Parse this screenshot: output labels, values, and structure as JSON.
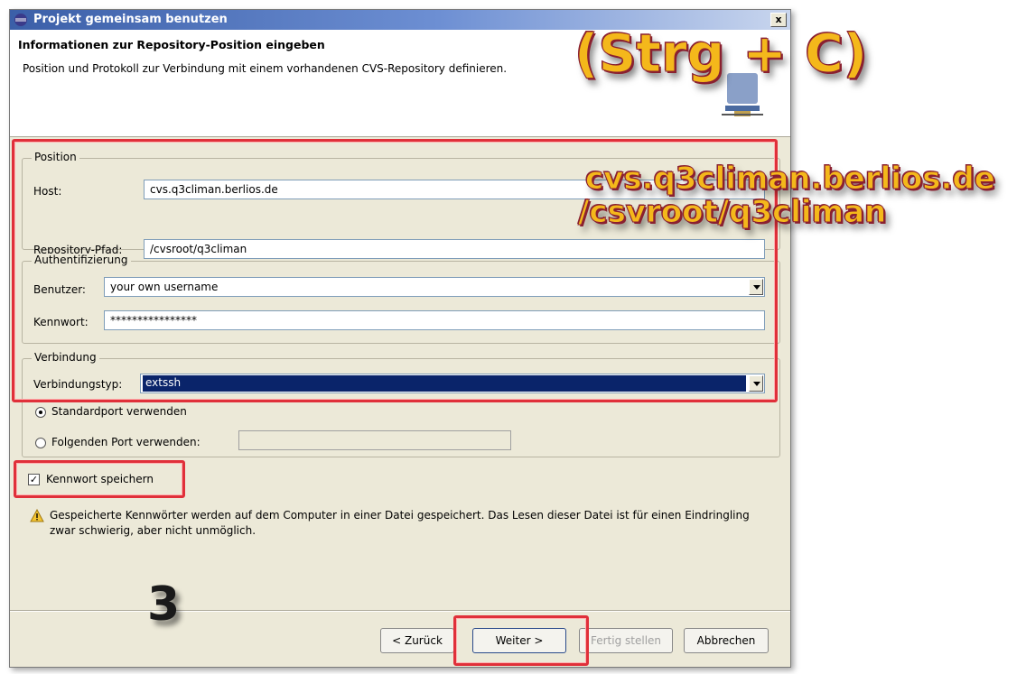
{
  "window": {
    "title": "Projekt gemeinsam benutzen",
    "close_label": "x"
  },
  "banner": {
    "heading": "Informationen zur Repository-Position eingeben",
    "description": "Position und Protokoll zur Verbindung mit einem vorhandenen CVS-Repository definieren."
  },
  "position_group": {
    "legend": "Position",
    "host_label": "Host:",
    "host_value": "cvs.q3climan.berlios.de",
    "path_label": "Repository-Pfad:",
    "path_value": "/cvsroot/q3climan"
  },
  "auth_group": {
    "legend": "Authentifizierung",
    "user_label": "Benutzer:",
    "user_value": "your own username",
    "password_label": "Kennwort:",
    "password_value": "****************"
  },
  "connection_group": {
    "legend": "Verbindung",
    "type_label": "Verbindungstyp:",
    "type_value": "extssh",
    "default_port_label": "Standardport verwenden",
    "custom_port_label": "Folgenden Port verwenden:",
    "default_port_selected": true
  },
  "save_password": {
    "label": "Kennwort speichern",
    "checked": true
  },
  "warning": {
    "text": "Gespeicherte Kennwörter werden auf dem Computer in einer Datei gespeichert. Das Lesen dieser Datei ist für einen Eindringling zwar schwierig, aber nicht unmöglich."
  },
  "buttons": {
    "back": "< Zurück",
    "next": "Weiter >",
    "finish": "Fertig stellen",
    "cancel": "Abbrechen"
  },
  "annotations": {
    "shortcut": "(Strg + C)",
    "host_hint": "cvs.q3climan.berlios.de",
    "path_hint": "/csvroot/q3climan",
    "step": "3"
  },
  "colors": {
    "highlight": "#e0303a",
    "overlay_text": "#f4b81b",
    "selection": "#0a246a"
  }
}
